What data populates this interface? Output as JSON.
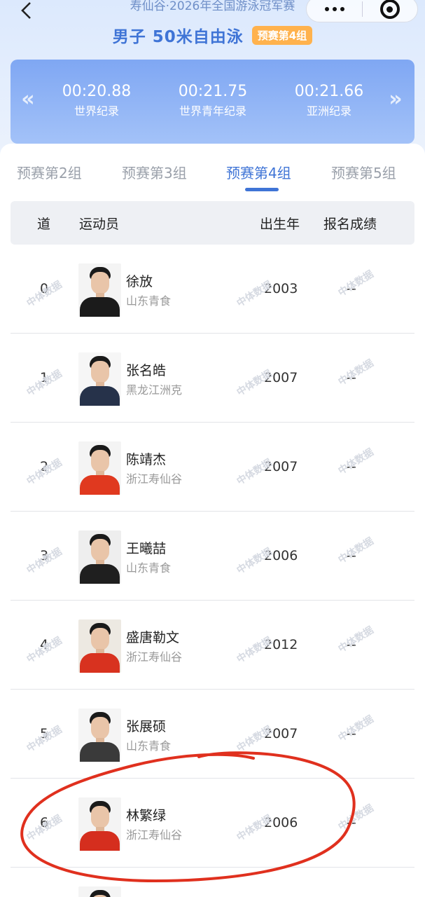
{
  "nav": {
    "competition_title": "寿仙谷·2026年全国游泳冠军赛",
    "back_icon": "chevron-left-icon",
    "more_icon": "more-dots-icon",
    "close_icon": "target-circle-icon"
  },
  "event": {
    "title": "男子 50米自由泳",
    "heat_badge": "预赛第4组"
  },
  "records": {
    "prev_icon": "«",
    "next_icon": "»",
    "items": [
      {
        "time": "00:20.88",
        "label": "世界纪录"
      },
      {
        "time": "00:21.75",
        "label": "世界青年纪录"
      },
      {
        "time": "00:21.66",
        "label": "亚洲纪录"
      }
    ]
  },
  "tabs": [
    {
      "label": "预赛第2组",
      "active": false
    },
    {
      "label": "预赛第3组",
      "active": false
    },
    {
      "label": "预赛第4组",
      "active": true
    },
    {
      "label": "预赛第5组",
      "active": false
    }
  ],
  "table": {
    "headers": [
      "道",
      "运动员",
      "出生年",
      "报名成绩"
    ],
    "rows": [
      {
        "lane": "0",
        "name": "徐放",
        "team": "山东青食",
        "year": "2003",
        "entry": "--"
      },
      {
        "lane": "1",
        "name": "张名皓",
        "team": "黑龙江洲克",
        "year": "2007",
        "entry": "--"
      },
      {
        "lane": "2",
        "name": "陈靖杰",
        "team": "浙江寿仙谷",
        "year": "2007",
        "entry": "--"
      },
      {
        "lane": "3",
        "name": "王曦喆",
        "team": "山东青食",
        "year": "2006",
        "entry": "--"
      },
      {
        "lane": "4",
        "name": "盛唐勒文",
        "team": "浙江寿仙谷",
        "year": "2012",
        "entry": "--"
      },
      {
        "lane": "5",
        "name": "张展硕",
        "team": "山东青食",
        "year": "2007",
        "entry": "--"
      },
      {
        "lane": "6",
        "name": "林繁绿",
        "team": "浙江寿仙谷",
        "year": "2006",
        "entry": "--"
      }
    ]
  },
  "watermark": "中体数据",
  "colors": {
    "accent": "#3f74d6",
    "badge": "#ffb24d",
    "record_panel": "#8db1f5",
    "annotation": "#e0301e"
  }
}
